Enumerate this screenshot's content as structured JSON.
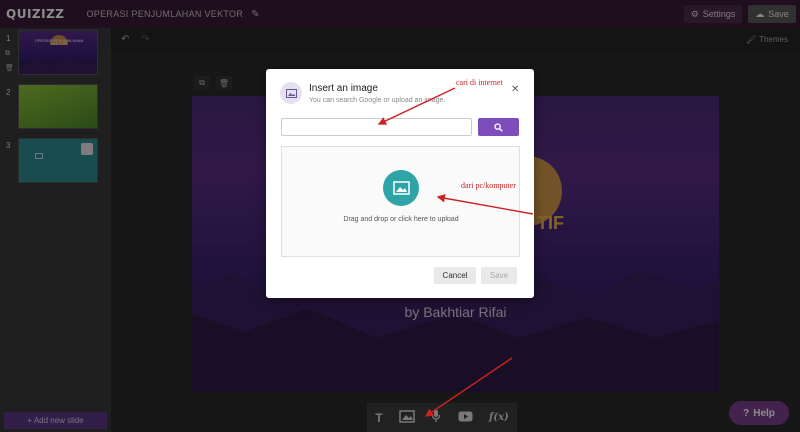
{
  "app": {
    "logo": "QUIZIZZ",
    "doc_title": "OPERASI PENJUMLAHAN VEKTOR",
    "settings_label": "Settings",
    "save_label": "Save"
  },
  "sidebar": {
    "slides": [
      {
        "number": "1",
        "title": "OPERASI PENJUMLAHAN VEKTOR"
      },
      {
        "number": "2"
      },
      {
        "number": "3"
      }
    ],
    "add_slide_label": "+ Add new slide"
  },
  "editor": {
    "themes_label": "Themes"
  },
  "canvas": {
    "title_fragment": "TIF",
    "author": "by Bakhtiar Rifai"
  },
  "toolbar": {
    "text_tool": "T",
    "math_tool": "f(x)"
  },
  "help": {
    "label": "Help"
  },
  "modal": {
    "title": "Insert an image",
    "subtitle": "You can search Google or upload an image.",
    "search_placeholder": "",
    "drop_text": "Drag and drop or click here to upload",
    "cancel_label": "Cancel",
    "save_label": "Save"
  },
  "annotations": {
    "internet_note": "cari di internet",
    "pc_note": "dari pc/komputer"
  },
  "colors": {
    "accent_purple": "#7c4dbb",
    "upload_teal": "#2fa4a7",
    "annotation_red": "#cc2222",
    "topbar": "#3a1b36"
  }
}
